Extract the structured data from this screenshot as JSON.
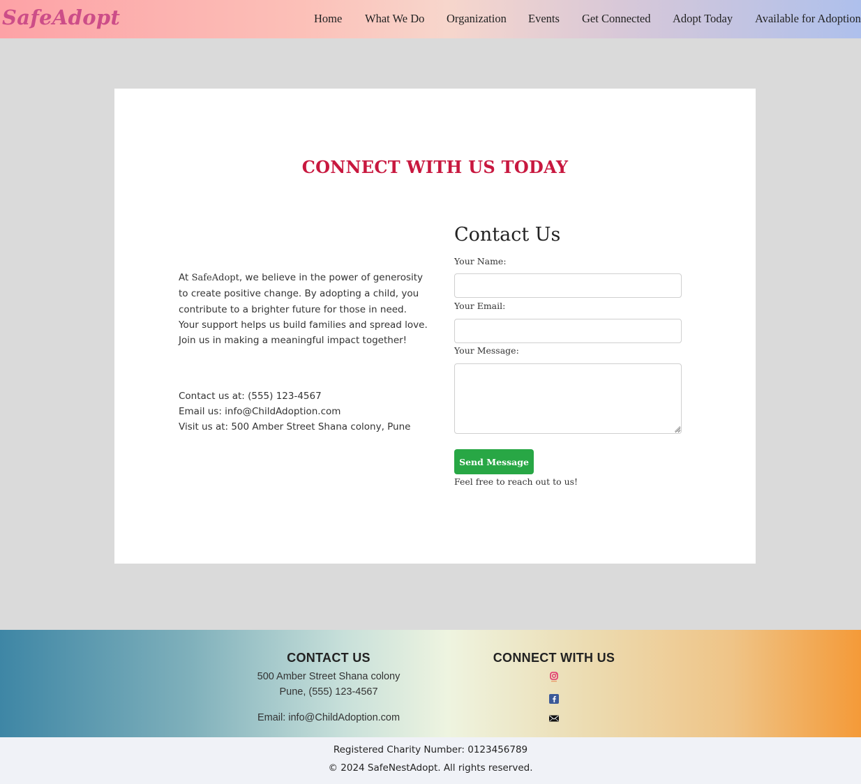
{
  "header": {
    "logo": "SafeAdopt",
    "nav": [
      "Home",
      "What We Do",
      "Organization",
      "Events",
      "Get Connected",
      "Adopt Today",
      "Available for Adoption"
    ]
  },
  "main": {
    "title": "CONNECT WITH US TODAY",
    "intro_prefix": "At ",
    "intro_brand": "SafeAdopt",
    "intro_suffix": ", we believe in the power of generosity to create positive change. By adopting a child, you contribute to a brighter future for those in need. Your support helps us build families and spread love. Join us in making a meaningful impact together!",
    "contact_phone": "Contact us at: (555) 123-4567",
    "contact_email": "Email us: info@ChildAdoption.com",
    "contact_address": "Visit us at: 500 Amber Street Shana colony, Pune",
    "form": {
      "heading": "Contact Us",
      "name_label": "Your Name:",
      "name_value": "",
      "email_label": "Your Email:",
      "email_value": "",
      "message_label": "Your Message:",
      "message_value": "",
      "submit_label": "Send Message",
      "note": "Feel free to reach out to us!"
    }
  },
  "footer": {
    "contact_heading": "CONTACT US",
    "address_line1": "500 Amber Street Shana colony",
    "address_line2": "Pune, (555) 123-4567",
    "email": "Email: info@ChildAdoption.com",
    "connect_heading": "CONNECT WITH US",
    "social_icons": [
      "instagram-icon",
      "facebook-icon",
      "mail-icon"
    ],
    "charity": "Registered Charity Number: 0123456789",
    "copyright": "© 2024 SafeNestAdopt. All rights reserved."
  },
  "colors": {
    "title_red": "#c8183f",
    "logo_pink": "#cc4d88",
    "button_green": "#28a745"
  }
}
